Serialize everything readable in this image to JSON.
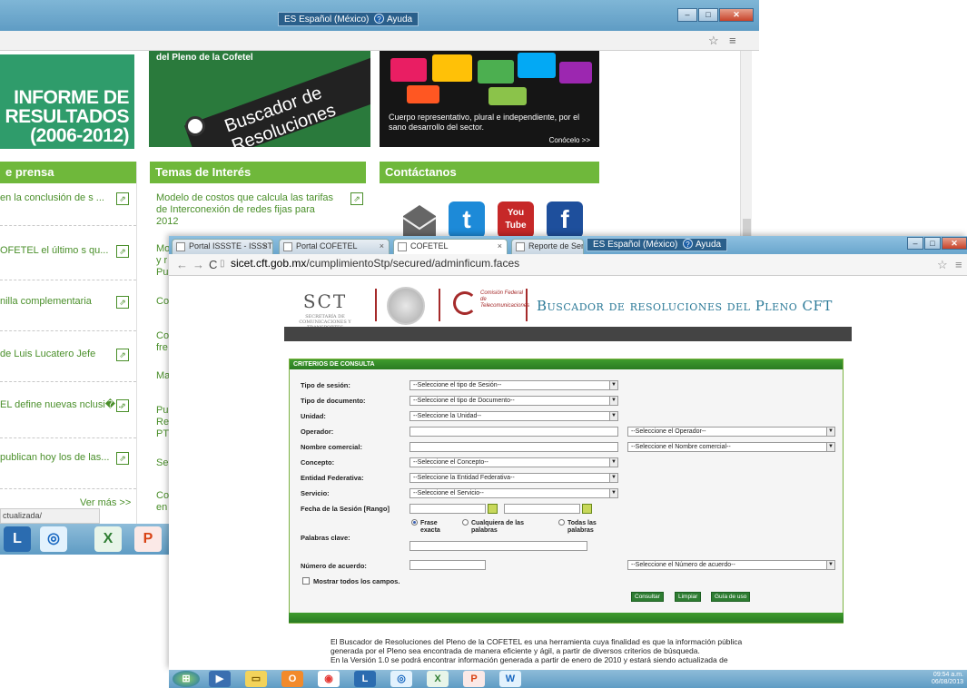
{
  "back_window": {
    "language_bar": "ES Español (México)",
    "help_label": "Ayuda",
    "informe_lines": [
      "INFORME DE",
      "RESULTADOS",
      "(2006-2012)"
    ],
    "banner_heading": "del Pleno de la Cofetel",
    "banner_text": "Buscador de Resoluciones",
    "consejo_text": "Cuerpo representativo, plural e independiente, por el sano desarrollo del sector.",
    "consejo_more": "Conócelo >>",
    "headings": {
      "prensa": "e prensa",
      "temas": "Temas de Interés",
      "contacto": "Contáctanos"
    },
    "news": [
      "en la conclusión de s ...",
      "OFETEL el último s qu...",
      "nilla complementaria",
      "de Luis Lucatero Jefe",
      "EL define nuevas nclusi�...",
      "publican hoy los de las..."
    ],
    "ver_mas": "Ver más >>",
    "temas": [
      "Modelo de costos que calcula las tarifas de Interconexión de redes fijas para 2012",
      "Mo y r Pu",
      "Co",
      "Co fre",
      "Ma",
      "Pu Re PT",
      "Se",
      "Co en"
    ],
    "status_text": "ctualizada/",
    "social_icons": [
      "mail-icon",
      "twitter-icon",
      "youtube-icon",
      "facebook-icon"
    ],
    "youtube_label": "You Tube"
  },
  "front_window": {
    "tabs": [
      "Portal ISSSTE - ISSSTE",
      "Portal COFETEL",
      "COFETEL",
      "Reporte de Sema"
    ],
    "language_bar": "ES Español (México)",
    "help_label": "Ayuda",
    "url_host": "sicet.cft.gob.mx",
    "url_path": "/cumplimientoStp/secured/adminficum.faces",
    "sct_logo": "SCT",
    "sct_sub": "SECRETARÍA DE COMUNICACIONES Y TRANSPORTES",
    "cofetel_text": "Comisión Federal de Telecomunicaciones",
    "page_title": "Buscador de resoluciones del Pleno CFT",
    "form_title": "CRITERIOS DE CONSULTA",
    "labels": {
      "tipo_sesion": "Tipo de sesión:",
      "tipo_documento": "Tipo de documento:",
      "unidad": "Unidad:",
      "operador": "Operador:",
      "nombre_comercial": "Nombre comercial:",
      "concepto": "Concepto:",
      "entidad": "Entidad Federativa:",
      "servicio": "Servicio:",
      "fecha": "Fecha de la Sesión [Rango]",
      "palabras": "Palabras clave:",
      "numero": "Número de acuerdo:",
      "mostrar": "Mostrar todos los campos."
    },
    "selects": {
      "tipo_sesion": "--Seleccione el tipo de Sesión--",
      "tipo_documento": "--Seleccione el tipo de Documento--",
      "unidad": "--Seleccione la Unidad--",
      "operador": "--Seleccione el Operador--",
      "nombre_comercial": "--Seleccione el Nombre comercial--",
      "concepto": "--Seleccione el Concepto--",
      "entidad": "--Seleccione la Entidad Federativa--",
      "servicio": "--Seleccione el Servicio--",
      "numero": "--Seleccione el Número de acuerdo--"
    },
    "radios": [
      "Frase exacta",
      "Cualquiera de las palabras",
      "Todas las palabras"
    ],
    "buttons": {
      "consultar": "Consultar",
      "limpiar": "Limpiar",
      "guia": "Guía de uso"
    },
    "description": [
      "El Buscador de Resoluciones del Pleno de la COFETEL es una herramienta cuya finalidad es que la información pública",
      "generada por el Pleno sea encontrada de manera eficiente y ágil, a partir de diversos criterios de búsqueda.",
      "En la Versión 1.0 se podrá encontrar información generada a partir de enero de 2010 y estará siendo actualizada de"
    ]
  },
  "taskbar": {
    "time": "09:54 a.m.",
    "date": "06/08/2013"
  }
}
